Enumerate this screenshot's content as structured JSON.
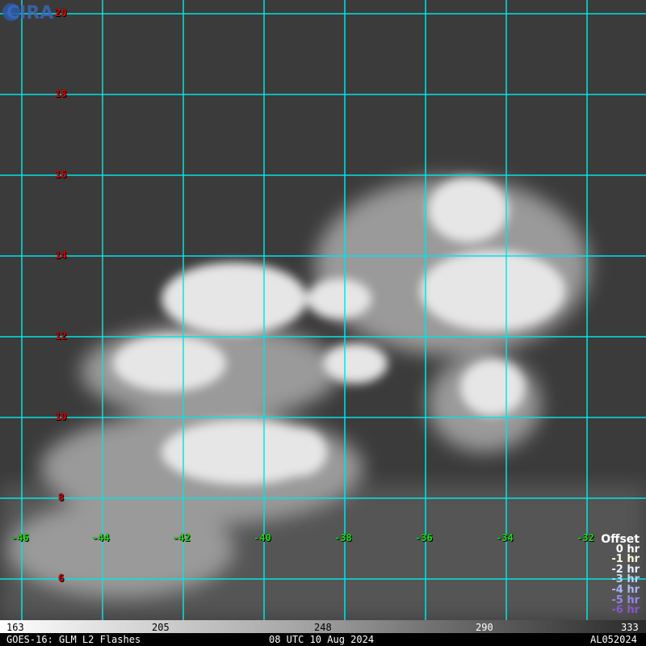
{
  "map": {
    "lat_labels": [
      "20",
      "18",
      "16",
      "14",
      "12",
      "10",
      "8",
      "6"
    ],
    "lon_labels": [
      "-46",
      "-44",
      "-42",
      "-40",
      "-38",
      "-36",
      "-34",
      "-32"
    ],
    "colors": {
      "grid": "#00e5e5",
      "lat_label": "#e00000",
      "lon_label": "#18e018"
    }
  },
  "legend": {
    "title": "Offset",
    "items": [
      {
        "label": "0 hr",
        "color": "#ffffff"
      },
      {
        "label": "-1 hr",
        "color": "#ffffe0"
      },
      {
        "label": "-2 hr",
        "color": "#e8f0ff"
      },
      {
        "label": "-3 hr",
        "color": "#b8d8f0"
      },
      {
        "label": "-4 hr",
        "color": "#a8b8f8"
      },
      {
        "label": "-5 hr",
        "color": "#9888e8"
      },
      {
        "label": "-6 hr",
        "color": "#8858c8"
      }
    ]
  },
  "colorbar": {
    "ticks": [
      "163",
      "205",
      "248",
      "290",
      "333"
    ]
  },
  "footer": {
    "left": "GOES-16: GLM L2 Flashes",
    "center": "08 UTC 10 Aug 2024",
    "right": "AL052024"
  },
  "logo": {
    "text": "CIRA"
  }
}
